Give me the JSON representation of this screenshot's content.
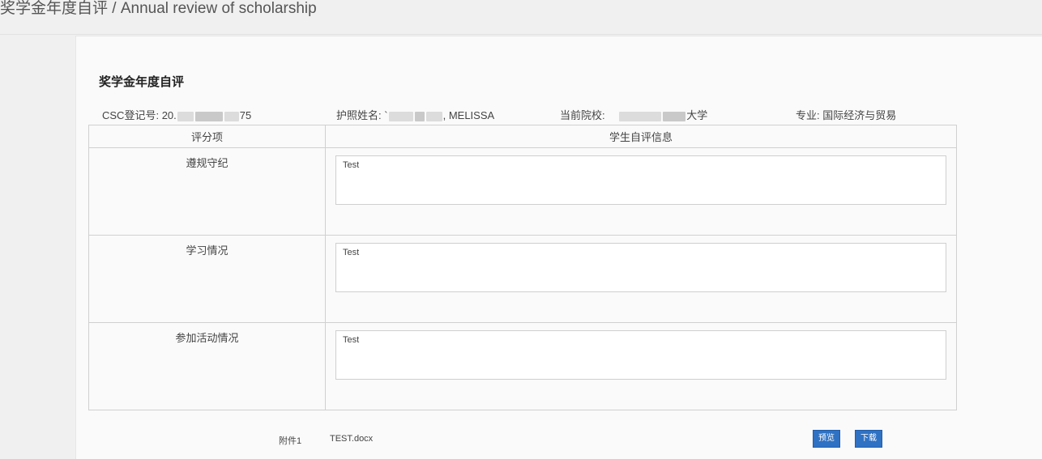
{
  "header": {
    "title": "奖学金年度自评 / Annual review of scholarship"
  },
  "panel": {
    "title": "奖学金年度自评"
  },
  "info": {
    "csc_label": "CSC登记号:",
    "csc_prefix": "20.",
    "csc_suffix": "75",
    "passport_label": "护照姓名:",
    "passport_prefix": "`",
    "passport_suffix": ", MELISSA",
    "school_label": "当前院校:",
    "school_suffix": "大学",
    "major_label": "专业:",
    "major_value": "国际经济与贸易"
  },
  "table": {
    "headers": [
      "评分项",
      "学生自评信息"
    ],
    "rows": [
      {
        "item": "遵规守纪",
        "answer": "Test"
      },
      {
        "item": "学习情况",
        "answer": "Test"
      },
      {
        "item": "参加活动情况",
        "answer": "Test"
      }
    ]
  },
  "attachment": {
    "label": "附件1",
    "file": "TEST.docx",
    "preview_label": "预览",
    "download_label": "下载"
  }
}
